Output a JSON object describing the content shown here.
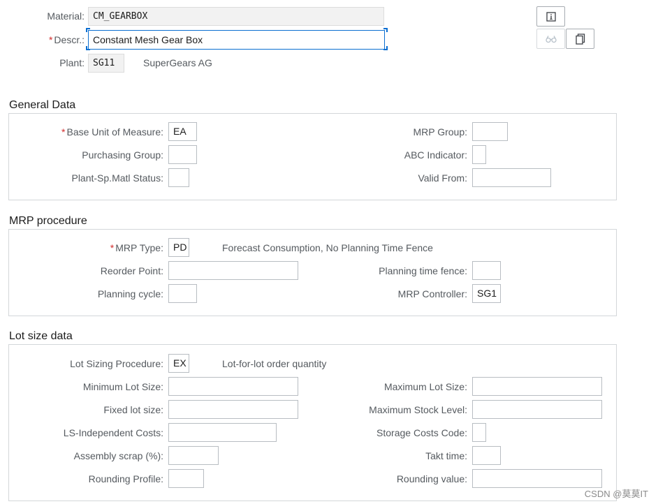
{
  "header": {
    "material_label": "Material:",
    "material_value": "CM_GEARBOX",
    "descr_label": "Descr.:",
    "descr_value": "Constant Mesh Gear Box",
    "plant_label": "Plant:",
    "plant_value": "SG11",
    "plant_name": "SuperGears AG",
    "required_marker": "*"
  },
  "toolbar": {
    "info_icon": "info-icon",
    "display_icon": "glasses-icon",
    "copy_icon": "copy-icon"
  },
  "general_data": {
    "title": "General Data",
    "base_uom_label": "Base Unit of Measure:",
    "base_uom_value": "EA",
    "mrp_group_label": "MRP Group:",
    "mrp_group_value": "",
    "purchasing_group_label": "Purchasing Group:",
    "purchasing_group_value": "",
    "abc_indicator_label": "ABC Indicator:",
    "abc_indicator_value": "",
    "plant_matl_status_label": "Plant-Sp.Matl Status:",
    "plant_matl_status_value": "",
    "valid_from_label": "Valid From:",
    "valid_from_value": ""
  },
  "mrp_procedure": {
    "title": "MRP procedure",
    "mrp_type_label": "MRP Type:",
    "mrp_type_value": "PD",
    "mrp_type_desc": "Forecast Consumption, No Planning Time Fence",
    "reorder_point_label": "Reorder Point:",
    "reorder_point_value": "",
    "planning_time_fence_label": "Planning time fence:",
    "planning_time_fence_value": "",
    "planning_cycle_label": "Planning cycle:",
    "planning_cycle_value": "",
    "mrp_controller_label": "MRP Controller:",
    "mrp_controller_value": "SG1"
  },
  "lot_size_data": {
    "title": "Lot size data",
    "lot_sizing_label": "Lot Sizing Procedure:",
    "lot_sizing_value": "EX",
    "lot_sizing_desc": "Lot-for-lot order quantity",
    "min_lot_label": "Minimum Lot Size:",
    "min_lot_value": "",
    "max_lot_label": "Maximum Lot Size:",
    "max_lot_value": "",
    "fixed_lot_label": "Fixed lot size:",
    "fixed_lot_value": "",
    "max_stock_label": "Maximum Stock Level:",
    "max_stock_value": "",
    "ls_costs_label": "LS-Independent Costs:",
    "ls_costs_value": "",
    "storage_costs_label": "Storage Costs Code:",
    "storage_costs_value": "",
    "assembly_scrap_label": "Assembly scrap (%):",
    "assembly_scrap_value": "",
    "takt_time_label": "Takt time:",
    "takt_time_value": "",
    "rounding_profile_label": "Rounding Profile:",
    "rounding_profile_value": "",
    "rounding_value_label": "Rounding value:",
    "rounding_value_value": ""
  },
  "watermark": "CSDN @莫莫IT",
  "colors": {
    "required": "#d22c2c",
    "focus": "#0a6ed1",
    "field_border": "#b8bdc2",
    "readonly_bg": "#f2f2f2"
  }
}
